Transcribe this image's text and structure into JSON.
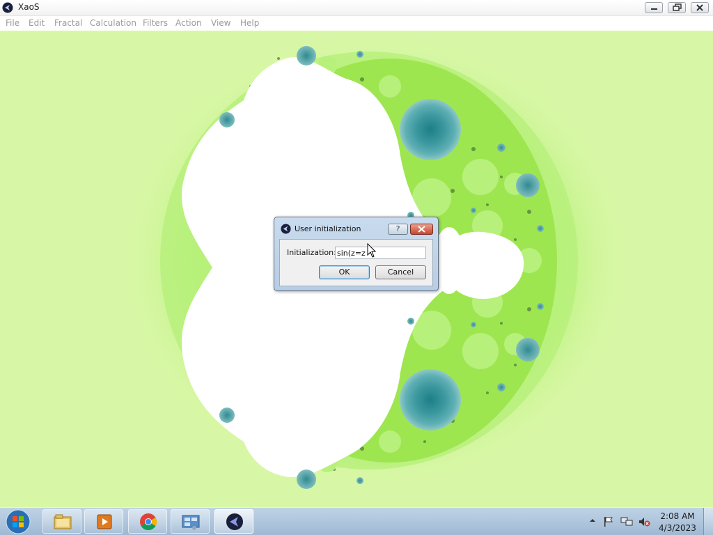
{
  "window": {
    "title": "XaoS",
    "app_icon": "xaos-icon",
    "controls": [
      "minimize-icon",
      "restore-icon",
      "close-icon"
    ]
  },
  "menu": {
    "items": [
      {
        "label": "File"
      },
      {
        "label": "Edit"
      },
      {
        "label": "Fractal"
      },
      {
        "label": "Calculation"
      },
      {
        "label": "Filters"
      },
      {
        "label": "Action"
      },
      {
        "label": "View"
      },
      {
        "label": "Help"
      }
    ],
    "text_color": "#9a9a9a"
  },
  "fractal": {
    "description_colors": {
      "background": "#d8f7a6",
      "bright_green": "#a8f05a",
      "set_interior": "#ffffff",
      "teal_bulbs": "#3f9aa0"
    }
  },
  "dialog": {
    "title": "User initialization",
    "help_label": "?",
    "init_label": "Initialization:",
    "init_value": "sin(z=z",
    "ok_label": "OK",
    "cancel_label": "Cancel"
  },
  "taskbar": {
    "pinned": [
      "file-explorer-icon",
      "media-player-icon",
      "chrome-icon",
      "control-panel-icon",
      "xaos-icon"
    ],
    "tray": [
      "show-hidden-icons-icon",
      "action-center-flag-icon",
      "network-icon",
      "volume-muted-icon"
    ],
    "clock": {
      "time": "2:08 AM",
      "date": "4/3/2023"
    }
  }
}
